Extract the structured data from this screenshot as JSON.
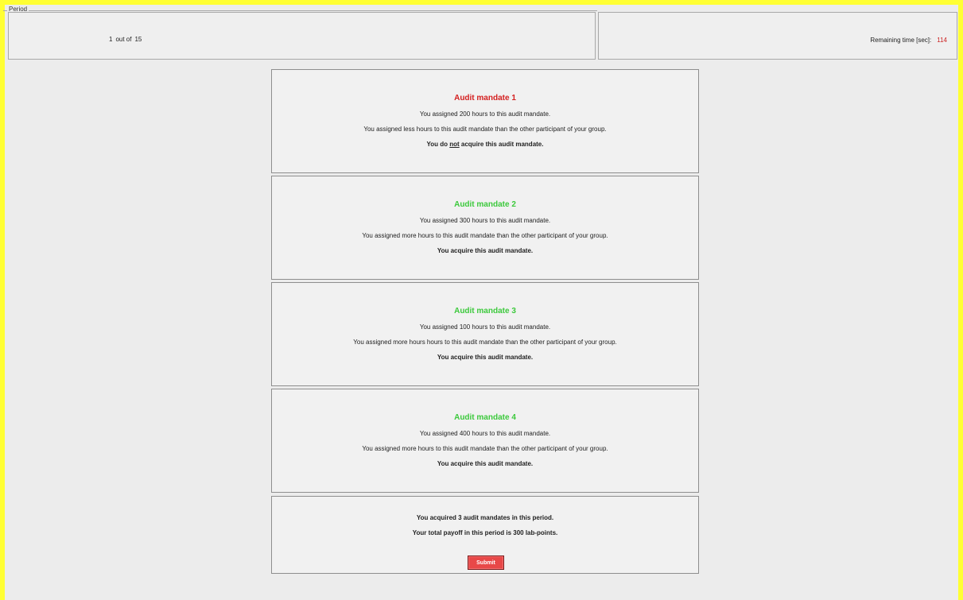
{
  "header": {
    "period_legend": "Period",
    "period_current": "1",
    "period_out_of": "out of",
    "period_total": "15",
    "remaining_label": "Remaining time [sec]:",
    "remaining_value": "114"
  },
  "mandates": [
    {
      "title": "Audit mandate 1",
      "status": "lost",
      "hours_line": "You assigned 200 hours to this audit mandate.",
      "compare_line": "You assigned less hours to this audit mandate than the other participant of your group.",
      "result_prefix": "You do ",
      "result_emph": "not",
      "result_suffix": " acquire this audit mandate."
    },
    {
      "title": "Audit mandate 2",
      "status": "won",
      "hours_line": "You assigned 300 hours to this audit mandate.",
      "compare_line": "You assigned more hours to this audit mandate than the other participant of your group.",
      "result": "You acquire this audit mandate."
    },
    {
      "title": "Audit mandate 3",
      "status": "won",
      "hours_line": "You assigned 100 hours to this audit mandate.",
      "compare_line": "You assigned more hours hours to this audit mandate than the other participant of your group.",
      "result": "You acquire this audit mandate."
    },
    {
      "title": "Audit mandate 4",
      "status": "won",
      "hours_line": "You assigned 400 hours to this audit mandate.",
      "compare_line": "You assigned more hours to this audit mandate than the other participant of your group.",
      "result": "You acquire this audit mandate."
    }
  ],
  "summary": {
    "acquired_line": "You acquired 3 audit mandates in this period.",
    "payoff_line": "Your total payoff in this period is 300 lab-points.",
    "submit_label": "Submit"
  },
  "colors": {
    "frame": "#ffff33",
    "lost": "#d42020",
    "won": "#3cc93c",
    "submit": "#e84848"
  }
}
